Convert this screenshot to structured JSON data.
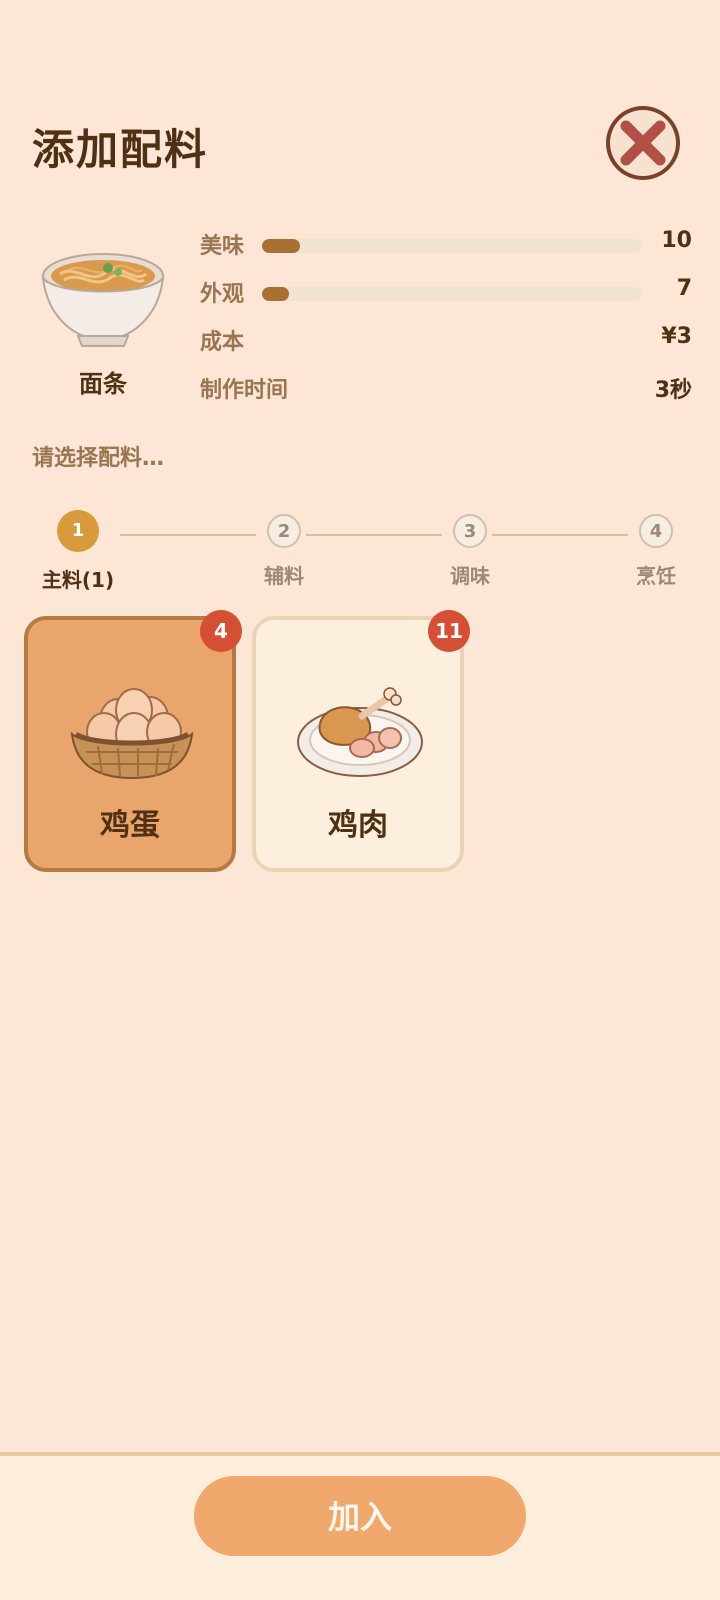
{
  "page": {
    "title": "添加配料",
    "hint": "请选择配料…"
  },
  "dish": {
    "name": "面条",
    "icon": "noodle-bowl-icon"
  },
  "stats": [
    {
      "label": "美味",
      "value": "10",
      "level": 0.1
    },
    {
      "label": "外观",
      "value": "7",
      "level": 0.07
    },
    {
      "label": "成本",
      "value": "¥3"
    },
    {
      "label": "制作时间",
      "value": "3秒"
    }
  ],
  "steps": [
    {
      "num": "1",
      "label": "主料(1)",
      "active": true
    },
    {
      "num": "2",
      "label": "辅料",
      "active": false
    },
    {
      "num": "3",
      "label": "调味",
      "active": false
    },
    {
      "num": "4",
      "label": "烹饪",
      "active": false
    }
  ],
  "ingredients": [
    {
      "name": "鸡蛋",
      "count": "4",
      "selected": true,
      "icon": "egg-basket-icon"
    },
    {
      "name": "鸡肉",
      "count": "11",
      "selected": false,
      "icon": "chicken-plate-icon"
    }
  ],
  "footer": {
    "join_label": "加入"
  },
  "colors": {
    "background": "#fde6d5",
    "accent": "#f0a86c",
    "badge": "#d44f33",
    "bar_fill": "#a86f33",
    "step_active": "#d89a3b"
  }
}
